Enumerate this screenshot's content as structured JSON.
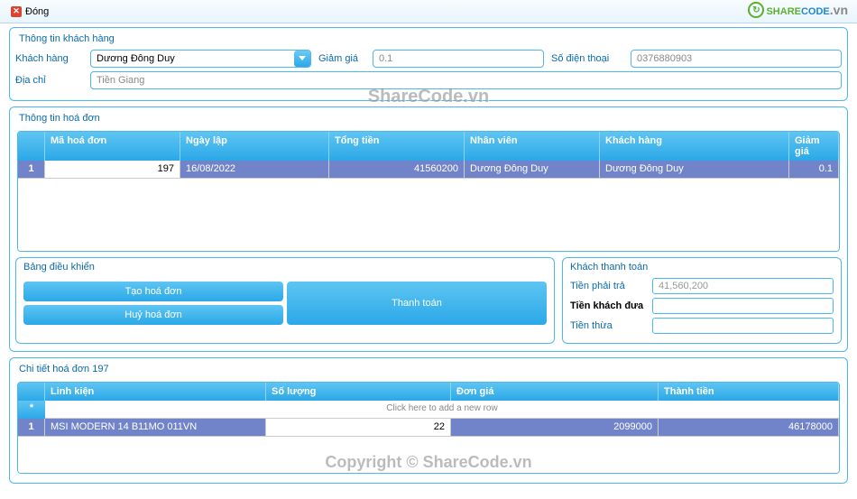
{
  "toolbar": {
    "close": "Đóng"
  },
  "logo": {
    "s": "SHARE",
    "c": "CODE",
    "vn": ".vn"
  },
  "customer": {
    "title": "Thông tin khách hàng",
    "lbl_kh": "Khách hàng",
    "val_kh": "Dương Đông Duy",
    "lbl_gg": "Giảm giá",
    "val_gg": "0.1",
    "lbl_sdt": "Số điện thoại",
    "val_sdt": "0376880903",
    "lbl_dc": "Địa chỉ",
    "val_dc": "Tiền Giang"
  },
  "invoice": {
    "title": "Thông tin hoá đơn",
    "cols": {
      "ma": "Mã hoá đơn",
      "ngay": "Ngày lập",
      "tong": "Tổng tiền",
      "nv": "Nhân viên",
      "kh": "Khách hàng",
      "gg": "Giảm giá"
    },
    "row": {
      "idx": "1",
      "ma": "197",
      "ngay": "16/08/2022",
      "tong": "41560200",
      "nv": "Dương Đông Duy",
      "kh": "Dương Đông Duy",
      "gg": "0.1"
    }
  },
  "ctrl": {
    "title": "Bảng điều khiển",
    "btn_tao": "Tạo hoá đơn",
    "btn_tt": "Thanh toán",
    "btn_huy": "Huỷ hoá đơn"
  },
  "pay": {
    "title": "Khách thanh toán",
    "lbl_phai": "Tiền phải trả",
    "val_phai": "41,560,200",
    "lbl_dua": "Tiền khách đưa",
    "lbl_thua": "Tiền thừa"
  },
  "detail": {
    "title": "Chi tiết hoá đơn 197",
    "cols": {
      "lk": "Linh kiện",
      "sl": "Số lượng",
      "dg": "Đơn giá",
      "tt": "Thành tiền"
    },
    "addrow": "Click here to add a new row",
    "row": {
      "idx": "1",
      "lk": "MSI MODERN 14 B11MO 011VN",
      "sl": "22",
      "dg": "2099000",
      "tt": "46178000"
    }
  },
  "wm1": "ShareCode.vn",
  "wm2": "Copyright © ShareCode.vn"
}
